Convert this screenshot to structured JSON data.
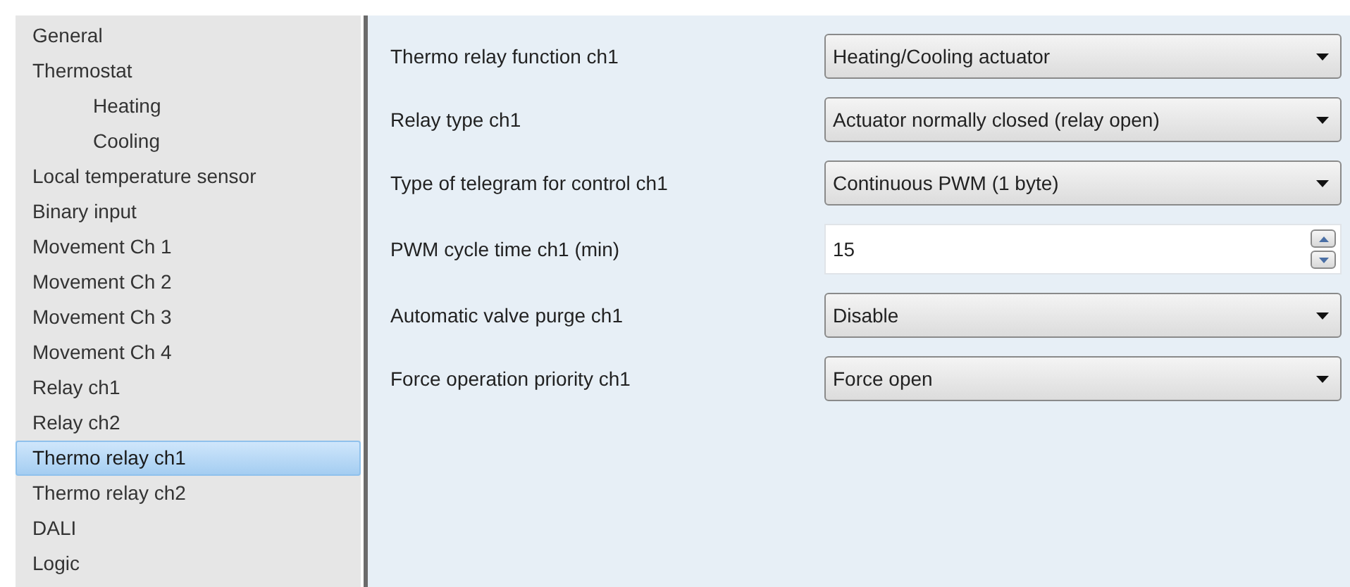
{
  "sidebar": {
    "items": [
      {
        "label": "General",
        "selected": false
      },
      {
        "label": "Thermostat",
        "selected": false,
        "children": [
          {
            "label": "Heating",
            "selected": false
          },
          {
            "label": "Cooling",
            "selected": false
          }
        ]
      },
      {
        "label": "Local temperature sensor",
        "selected": false
      },
      {
        "label": "Binary input",
        "selected": false
      },
      {
        "label": "Movement Ch 1",
        "selected": false
      },
      {
        "label": "Movement Ch 2",
        "selected": false
      },
      {
        "label": "Movement Ch 3",
        "selected": false
      },
      {
        "label": "Movement Ch 4",
        "selected": false
      },
      {
        "label": "Relay ch1",
        "selected": false
      },
      {
        "label": "Relay ch2",
        "selected": false
      },
      {
        "label": "Thermo relay ch1",
        "selected": true
      },
      {
        "label": "Thermo relay ch2",
        "selected": false
      },
      {
        "label": "DALI",
        "selected": false
      },
      {
        "label": "Logic",
        "selected": false
      }
    ]
  },
  "parameters": [
    {
      "label": "Thermo relay function ch1",
      "kind": "dropdown",
      "value": "Heating/Cooling actuator"
    },
    {
      "label": "Relay type ch1",
      "kind": "dropdown",
      "value": "Actuator normally closed (relay open)"
    },
    {
      "label": "Type of telegram for control ch1",
      "kind": "dropdown",
      "value": "Continuous PWM (1 byte)"
    },
    {
      "label": "PWM cycle time ch1 (min)",
      "kind": "spinner",
      "value": "15"
    },
    {
      "label": "Automatic valve purge ch1",
      "kind": "dropdown",
      "value": "Disable"
    },
    {
      "label": "Force operation priority ch1",
      "kind": "dropdown",
      "value": "Force open"
    }
  ]
}
